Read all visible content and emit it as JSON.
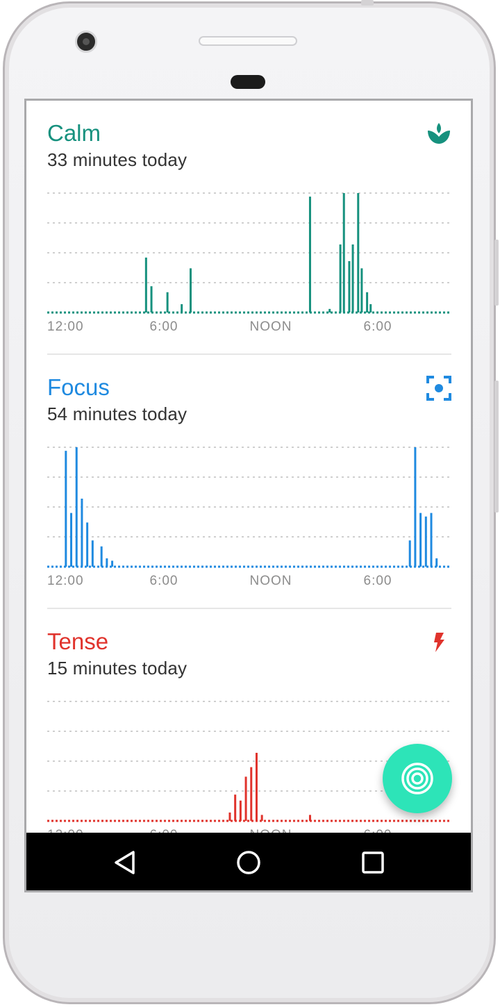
{
  "colors": {
    "calm": "#16917e",
    "focus": "#1f8ae0",
    "tense": "#e0332c",
    "fab": "#2de4b8"
  },
  "x_ticks": [
    "12:00",
    "6:00",
    "NOON",
    "6:00"
  ],
  "sections": [
    {
      "title": "Calm",
      "subtitle": "33 minutes today",
      "icon": "lotus-icon"
    },
    {
      "title": "Focus",
      "subtitle": "54 minutes today",
      "icon": "focus-target-icon"
    },
    {
      "title": "Tense",
      "subtitle": "15 minutes today",
      "icon": "lightning-icon"
    }
  ],
  "fab": {
    "icon": "concentric-circles-icon"
  },
  "navbar": {
    "back": "back-triangle-icon",
    "home": "home-circle-icon",
    "recents": "recents-square-icon"
  },
  "chart_data": [
    {
      "type": "bar",
      "series": [
        {
          "name": "Calm",
          "x_hours": [
            5.0,
            5.3,
            6.2,
            7.0,
            7.5,
            14.2,
            15.3,
            15.9,
            16.1,
            16.4,
            16.6,
            16.9,
            17.1,
            17.4,
            17.6,
            17.9
          ],
          "values": [
            0.46,
            0.22,
            0.17,
            0.07,
            0.37,
            0.97,
            0.03,
            0.57,
            1.0,
            0.43,
            0.57,
            1.0,
            0.37,
            0.17,
            0.07,
            0.0
          ]
        }
      ],
      "ylim": [
        0,
        1
      ],
      "grid": true
    },
    {
      "type": "bar",
      "series": [
        {
          "name": "Focus",
          "x_hours": [
            0.5,
            0.8,
            1.1,
            1.4,
            1.7,
            2.0,
            2.5,
            2.8,
            3.1,
            19.8,
            20.1,
            20.4,
            20.7,
            21.0,
            21.3
          ],
          "values": [
            0.97,
            0.45,
            1.0,
            0.57,
            0.37,
            0.22,
            0.17,
            0.07,
            0.05,
            0.22,
            1.0,
            0.45,
            0.42,
            0.45,
            0.07
          ]
        }
      ],
      "ylim": [
        0,
        1
      ],
      "grid": true
    },
    {
      "type": "bar",
      "series": [
        {
          "name": "Tense",
          "x_hours": [
            9.7,
            10.0,
            10.3,
            10.6,
            10.9,
            11.2,
            11.5,
            14.2
          ],
          "values": [
            0.07,
            0.22,
            0.17,
            0.37,
            0.45,
            0.57,
            0.05,
            0.05
          ]
        }
      ],
      "ylim": [
        0,
        1
      ],
      "grid": true
    }
  ]
}
